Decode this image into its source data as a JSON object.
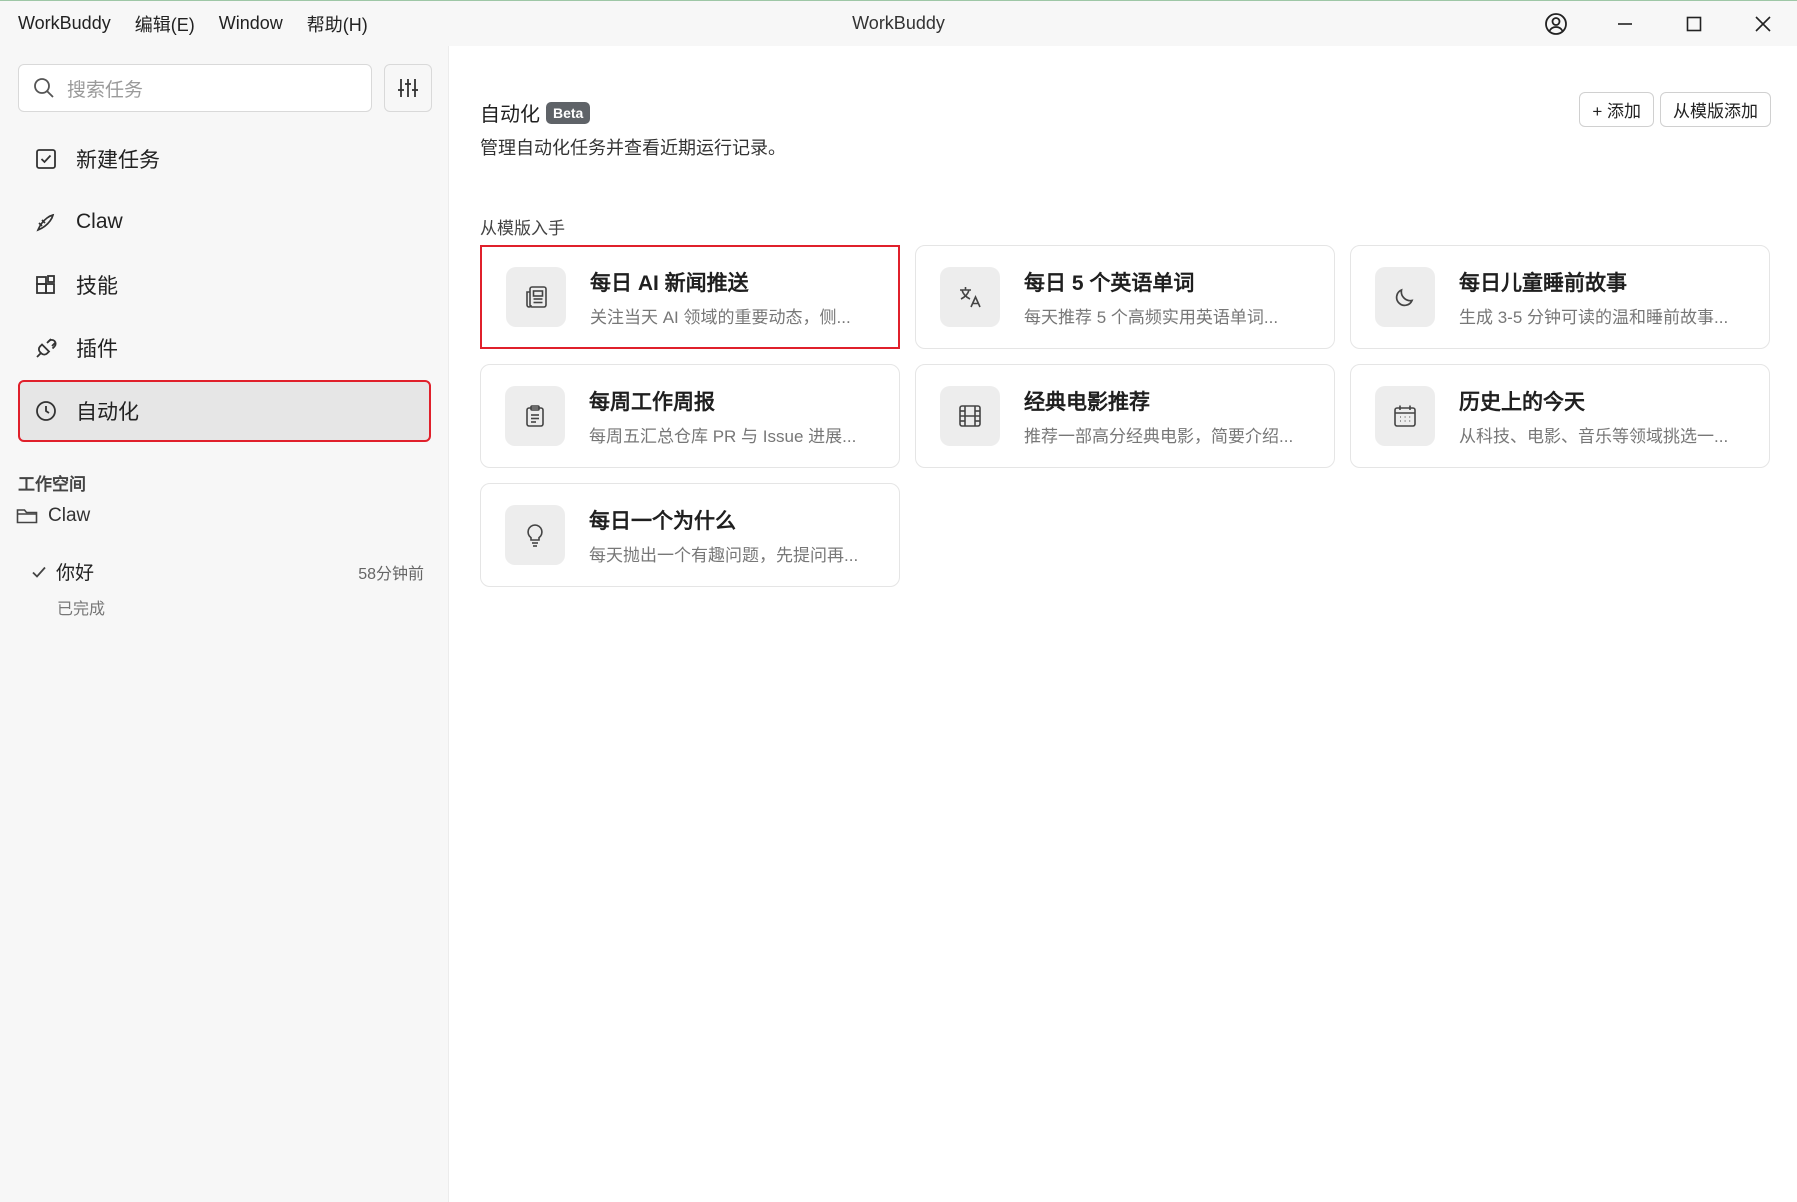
{
  "titlebar": {
    "menu": [
      "WorkBuddy",
      "编辑(E)",
      "Window",
      "帮助(H)"
    ],
    "title": "WorkBuddy"
  },
  "sidebar": {
    "search_placeholder": "搜索任务",
    "nav": [
      {
        "label": "新建任务",
        "icon": "new-task-icon"
      },
      {
        "label": "Claw",
        "icon": "claw-icon"
      },
      {
        "label": "技能",
        "icon": "skills-icon"
      },
      {
        "label": "插件",
        "icon": "plugin-icon"
      },
      {
        "label": "自动化",
        "icon": "clock-icon",
        "active": true
      }
    ],
    "workspace_title": "工作空间",
    "workspace_folder": "Claw",
    "task": {
      "title": "你好",
      "time": "58分钟前",
      "status": "已完成"
    }
  },
  "main": {
    "title": "自动化",
    "badge": "Beta",
    "description": "管理自动化任务并查看近期运行记录。",
    "add_button": "+ 添加",
    "add_template_button": "从模版添加",
    "section_title": "从模版入手",
    "templates": [
      {
        "title": "每日 AI 新闻推送",
        "desc": "关注当天 AI 领域的重要动态，侧...",
        "icon": "newspaper-icon"
      },
      {
        "title": "每日 5 个英语单词",
        "desc": "每天推荐 5 个高频实用英语单词...",
        "icon": "translate-icon"
      },
      {
        "title": "每日儿童睡前故事",
        "desc": "生成 3-5 分钟可读的温和睡前故事...",
        "icon": "moon-icon"
      },
      {
        "title": "每周工作周报",
        "desc": "每周五汇总仓库 PR 与 Issue 进展...",
        "icon": "clipboard-icon"
      },
      {
        "title": "经典电影推荐",
        "desc": "推荐一部高分经典电影，简要介绍...",
        "icon": "film-icon"
      },
      {
        "title": "历史上的今天",
        "desc": "从科技、电影、音乐等领域挑选一...",
        "icon": "calendar-icon"
      },
      {
        "title": "每日一个为什么",
        "desc": "每天抛出一个有趣问题，先提问再...",
        "icon": "lightbulb-icon"
      }
    ]
  },
  "colors": {
    "highlight": "#e0202b",
    "badge_bg": "#5f6368",
    "sidebar_bg": "#f7f7f7"
  }
}
